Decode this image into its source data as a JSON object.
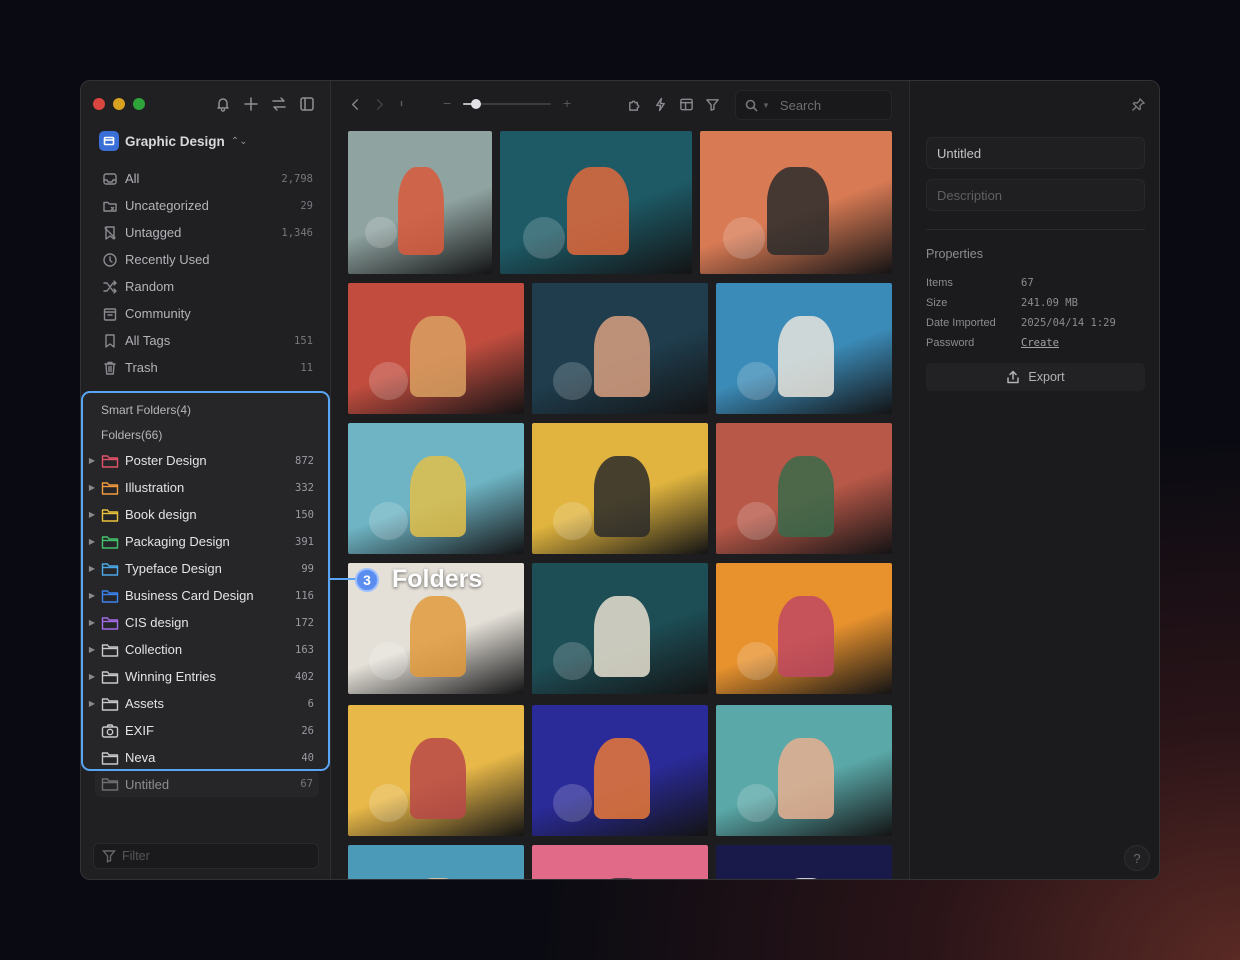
{
  "library": {
    "name": "Graphic Design"
  },
  "nav": [
    {
      "label": "All",
      "count": "2,798",
      "icon": "inbox-icon"
    },
    {
      "label": "Uncategorized",
      "count": "29",
      "icon": "folder-question-icon"
    },
    {
      "label": "Untagged",
      "count": "1,346",
      "icon": "untagged-icon"
    },
    {
      "label": "Recently Used",
      "count": "",
      "icon": "clock-icon"
    },
    {
      "label": "Random",
      "count": "",
      "icon": "shuffle-icon"
    },
    {
      "label": "Community",
      "count": "",
      "icon": "community-icon"
    },
    {
      "label": "All Tags",
      "count": "151",
      "icon": "bookmark-icon"
    },
    {
      "label": "Trash",
      "count": "11",
      "icon": "trash-icon"
    }
  ],
  "sections": {
    "smart_folders": "Smart Folders(4)",
    "folders": "Folders(66)"
  },
  "folders": [
    {
      "label": "Poster Design",
      "count": "872",
      "color": "#e2536a",
      "icon": "folder-icon"
    },
    {
      "label": "Illustration",
      "count": "332",
      "color": "#f09a3e",
      "icon": "folder-icon"
    },
    {
      "label": "Book design",
      "count": "150",
      "color": "#e8c23a",
      "icon": "folder-icon"
    },
    {
      "label": "Packaging Design",
      "count": "391",
      "color": "#43c06a",
      "icon": "folder-icon"
    },
    {
      "label": "Typeface Design",
      "count": "99",
      "color": "#4aa8e8",
      "icon": "folder-icon"
    },
    {
      "label": "Business Card Design",
      "count": "116",
      "color": "#3b82f0",
      "icon": "folder-icon"
    },
    {
      "label": "CIS design",
      "count": "172",
      "color": "#a46be8",
      "icon": "folder-icon"
    },
    {
      "label": "Collection",
      "count": "163",
      "color": "#c9c9cc",
      "icon": "folder-icon"
    },
    {
      "label": "Winning Entries",
      "count": "402",
      "color": "#c9c9cc",
      "icon": "folder-icon"
    },
    {
      "label": "Assets",
      "count": "6",
      "color": "#c9c9cc",
      "icon": "folder-icon"
    },
    {
      "label": "EXIF",
      "count": "26",
      "color": "#c9c9cc",
      "icon": "camera-icon"
    },
    {
      "label": "Neva",
      "count": "40",
      "color": "#c9c9cc",
      "icon": "folder-icon"
    }
  ],
  "untitled_folder": {
    "label": "Untitled",
    "count": "67"
  },
  "filter": {
    "placeholder": "Filter"
  },
  "toolbar": {
    "search_placeholder": "Search",
    "zoom": 0.15
  },
  "callout": {
    "number": "3",
    "text": "Folders"
  },
  "inspector": {
    "name": "Untitled",
    "description_placeholder": "Description",
    "properties_title": "Properties",
    "properties": [
      {
        "key": "Items",
        "value": "67"
      },
      {
        "key": "Size",
        "value": "241.09 MB"
      },
      {
        "key": "Date Imported",
        "value": "2025/04/14 1:29"
      },
      {
        "key": "Password",
        "value": "Create"
      }
    ],
    "export_label": "Export",
    "help": "?"
  },
  "thumbnails": [
    {
      "bg": "#8fa3a0",
      "accent": "#d95a3c",
      "name": "thumb-man-with-cat"
    },
    {
      "bg": "#1d5a66",
      "accent": "#e0683c",
      "name": "thumb-robot-vr"
    },
    {
      "bg": "#d87a54",
      "accent": "#2b2b2b",
      "name": "thumb-man-black-cats"
    },
    {
      "bg": "#c24d3f",
      "accent": "#d9a060",
      "name": "thumb-cat-woman-bird"
    },
    {
      "bg": "#1f3d4d",
      "accent": "#d8a080",
      "name": "thumb-woman-in-pond"
    },
    {
      "bg": "#3b8bb8",
      "accent": "#e8e4dc",
      "name": "thumb-chef-machine"
    },
    {
      "bg": "#6eb4c4",
      "accent": "#e2c04a",
      "name": "thumb-city-walker"
    },
    {
      "bg": "#e0b43e",
      "accent": "#2a2a2a",
      "name": "thumb-30k-cat"
    },
    {
      "bg": "#b85848",
      "accent": "#3a6a4a",
      "name": "thumb-windows"
    },
    {
      "bg": "#e4e0d8",
      "accent": "#e09a3c",
      "name": "thumb-delivery-boxes"
    },
    {
      "bg": "#1d4d55",
      "accent": "#e8e0d0",
      "name": "thumb-old-woman"
    },
    {
      "bg": "#e8922e",
      "accent": "#c04860",
      "name": "thumb-autumn-photographer"
    },
    {
      "bg": "#e8b848",
      "accent": "#b84848",
      "name": "thumb-portrait-grid"
    },
    {
      "bg": "#2a2a98",
      "accent": "#e87838",
      "name": "thumb-bearded-man-cat"
    },
    {
      "bg": "#5aa8a8",
      "accent": "#e8b090",
      "name": "thumb-woman-cat-leaves"
    },
    {
      "bg": "#4a9ab8",
      "accent": "#e8c8a8",
      "name": "thumb-beach"
    },
    {
      "bg": "#e06a88",
      "accent": "#3a2a3a",
      "name": "thumb-pink-dancer"
    },
    {
      "bg": "#1a1a4a",
      "accent": "#e8e8f0",
      "name": "thumb-night-sky"
    }
  ]
}
